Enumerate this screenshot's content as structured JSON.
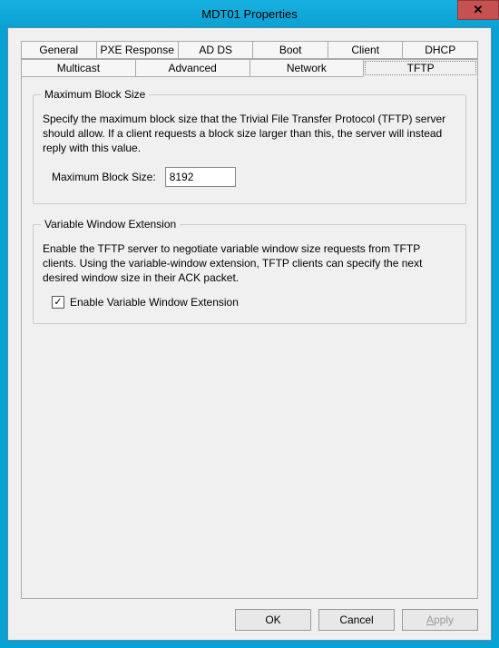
{
  "window": {
    "title": "MDT01 Properties",
    "close_glyph": "✕"
  },
  "tabs": {
    "row1": [
      "General",
      "PXE Response",
      "AD DS",
      "Boot",
      "Client",
      "DHCP"
    ],
    "row2": [
      "Multicast",
      "Advanced",
      "Network",
      "TFTP"
    ],
    "active": "TFTP"
  },
  "group_block": {
    "title": "Maximum Block Size",
    "description": "Specify the maximum block size that the Trivial File Transfer Protocol (TFTP) server should allow. If a client requests a block size larger than this, the server will instead reply with this value.",
    "field_label": "Maximum Block Size:",
    "value": "8192"
  },
  "group_window": {
    "title": "Variable Window Extension",
    "description": "Enable the TFTP server to negotiate variable window size requests from TFTP clients. Using the variable-window extension, TFTP clients can specify the next desired window size in their ACK packet.",
    "checkbox_label": "Enable Variable Window Extension",
    "checked": true,
    "check_glyph": "✓"
  },
  "buttons": {
    "ok": "OK",
    "cancel": "Cancel",
    "apply": "pply",
    "apply_mnemonic": "A"
  }
}
